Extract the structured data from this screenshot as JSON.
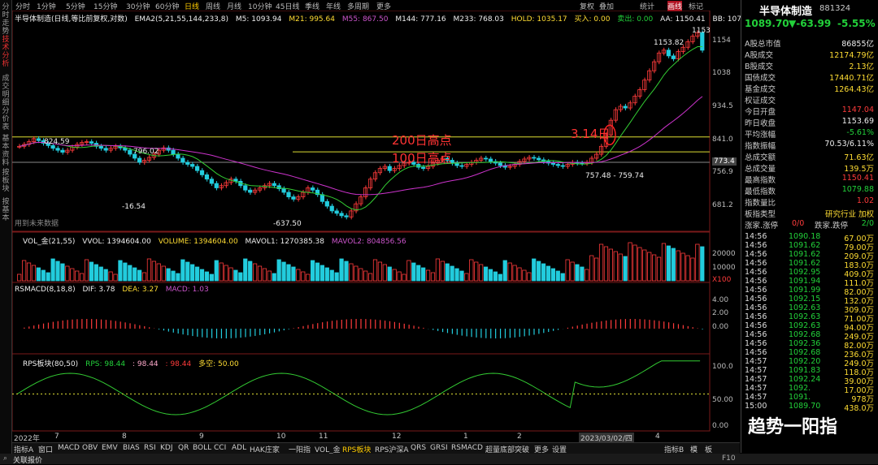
{
  "left_tabs": [
    "分时走势",
    "技术分析",
    "成交明细",
    "分价表",
    "基本资料",
    "按板块",
    "按基本"
  ],
  "toolbar": {
    "periods": [
      "分时",
      "1分钟",
      "5分钟",
      "15分钟",
      "30分钟",
      "60分钟",
      "日线",
      "周线",
      "月线",
      "10分钟",
      "45日线",
      "季线",
      "年线",
      "多周期",
      "更多"
    ],
    "selected_period": "日线",
    "right": [
      "复权",
      "叠加",
      "统计",
      "画线",
      "标记"
    ],
    "active_right": "画线"
  },
  "price_legend": {
    "title": "半导体制造(日线,等比前复权,对数)",
    "ema": "EMA2(5,21,55,144,233,8)",
    "m5": "M5: 1093.94",
    "m21": "M21: 995.64",
    "m55": "M55: 867.50",
    "m144": "M144: 777.16",
    "m233": "M233: 768.03",
    "hold": "HOLD: 1035.17",
    "buy": "买入: 0.00",
    "sell": "卖出: 0.00",
    "aa": "AA: 1150.41",
    "bb": "BB: 1079.88"
  },
  "annotations": {
    "high_label": "1153.82",
    "top_tick": "1153",
    "peak1": "824.59",
    "peak2": "796.02",
    "low1": "-16.54",
    "low2": "-637.50",
    "mid": "757.48 - 759.74",
    "line200": "200日高点",
    "line100": "100日高点",
    "circle": "3.14日",
    "future": "用到未来数据"
  },
  "price_ticks": [
    "1154",
    "1038",
    "934.5",
    "841.0",
    "773.4",
    "756.9",
    "681.2"
  ],
  "vol_legend": {
    "title": "VOL_金(21,55)",
    "vvol": "VVOL: 1394604.00",
    "volume": "VOLUME: 1394604.00",
    "mavol1": "MAVOL1: 1270385.38",
    "mavol2": "MAVOL2: 804856.56"
  },
  "vol_ticks": [
    "20000",
    "10000",
    "X100"
  ],
  "macd_legend": {
    "title": "RSMACD(8,18,8)",
    "dif": "DIF: 3.78",
    "dea": "DEA: 3.27",
    "macd": "MACD: 1.03"
  },
  "macd_ticks": [
    "4.00",
    "2.00",
    "0.00"
  ],
  "rps_legend": {
    "title": "RPS板块(80,50)",
    "rps": "RPS: 98.44",
    "v1": ": 98.44",
    "v2": ": 98.44",
    "duo": "多空: 50.00"
  },
  "rps_ticks": [
    "100.0",
    "50.00",
    "0.00"
  ],
  "x_axis": [
    "2022年",
    "7",
    "8",
    "9",
    "10",
    "11",
    "12",
    "1",
    "2",
    "2023/03/02/四",
    "4"
  ],
  "bottom_tabs": [
    "指标A",
    "窗口",
    "MACD",
    "OBV",
    "EMV",
    "BIAS",
    "RSI",
    "KDJ",
    "QR",
    "BOLL",
    "CCI",
    "ADL",
    "HAK庄家",
    "一阳指",
    "VOL_金",
    "RPS板块",
    "RPS沪深A",
    "QRS",
    "GRSI",
    "RSMACD",
    "超量底部突破",
    "更多",
    "设置"
  ],
  "bottom_right": [
    "指标B",
    "模",
    "板"
  ],
  "status_text": "关联报价",
  "status_right": "F10",
  "panel": {
    "title": "半导体制造",
    "code": "881324",
    "price": "1089.70",
    "change": "▼-63.99",
    "pct": "-5.55%",
    "rows": [
      {
        "k": "A股总市值",
        "v": "86855亿",
        "c": "white"
      },
      {
        "k": "A股成交",
        "v": "12174.79亿",
        "c": "yellow"
      },
      {
        "k": "B股成交",
        "v": "2.13亿",
        "c": "yellow"
      },
      {
        "k": "国债成交",
        "v": "17440.71亿",
        "c": "yellow"
      },
      {
        "k": "基金成交",
        "v": "1264.43亿",
        "c": "yellow"
      },
      {
        "k": "权证成交",
        "v": "",
        "c": "white"
      },
      {
        "k": "今日开盘",
        "v": "1147.04",
        "c": "red"
      },
      {
        "k": "昨日收盘",
        "v": "1153.69",
        "c": "white"
      },
      {
        "k": "平均涨幅",
        "v": "-5.61%",
        "c": "green"
      },
      {
        "k": "指数振幅",
        "v": "70.53/6.11%",
        "c": "white"
      },
      {
        "k": "总成交额",
        "v": "71.63亿",
        "c": "yellow"
      },
      {
        "k": "总成交量",
        "v": "139.5万",
        "c": "yellow"
      },
      {
        "k": "最高指数",
        "v": "1150.41",
        "c": "red"
      },
      {
        "k": "最低指数",
        "v": "1079.88",
        "c": "green"
      },
      {
        "k": "指数量比",
        "v": "1.02",
        "c": "red"
      }
    ],
    "sector_label": "板指类型",
    "sector_value": "研究行业 加权",
    "updown": {
      "k1": "涨家.涨停",
      "v1": "0/0",
      "k2": "跌家.跌停",
      "v2": "2/0"
    },
    "trades": [
      {
        "t": "14:56",
        "p": "1090.18",
        "v": "67.00万"
      },
      {
        "t": "14:56",
        "p": "1091.62",
        "v": "79.00万"
      },
      {
        "t": "14:56",
        "p": "1091.62",
        "v": "209.0万"
      },
      {
        "t": "14:56",
        "p": "1091.62",
        "v": "183.0万"
      },
      {
        "t": "14:56",
        "p": "1092.95",
        "v": "409.0万"
      },
      {
        "t": "14:56",
        "p": "1091.94",
        "v": "111.0万"
      },
      {
        "t": "14:56",
        "p": "1091.99",
        "v": "82.00万"
      },
      {
        "t": "14:56",
        "p": "1092.15",
        "v": "132.0万"
      },
      {
        "t": "14:56",
        "p": "1092.63",
        "v": "309.0万"
      },
      {
        "t": "14:56",
        "p": "1092.63",
        "v": "71.00万"
      },
      {
        "t": "14:56",
        "p": "1092.63",
        "v": "94.00万"
      },
      {
        "t": "14:56",
        "p": "1092.68",
        "v": "249.0万"
      },
      {
        "t": "14:56",
        "p": "1092.36",
        "v": "82.00万"
      },
      {
        "t": "14:56",
        "p": "1092.68",
        "v": "236.0万"
      },
      {
        "t": "14:57",
        "p": "1092.20",
        "v": "249.0万"
      },
      {
        "t": "14:57",
        "p": "1091.83",
        "v": "118.0万"
      },
      {
        "t": "14:57",
        "p": "1092.24",
        "v": "39.00万"
      },
      {
        "t": "14:57",
        "p": "1092.",
        "v": "17.00万"
      },
      {
        "t": "14:57",
        "p": "1091.",
        "v": "978万"
      },
      {
        "t": "15:00",
        "p": "1089.70",
        "v": "438.0万"
      }
    ]
  },
  "watermark": "趋势一阳指",
  "colors": {
    "up": "#ff3b3b",
    "down": "#22ccdd",
    "ma_yellow": "#ffee44",
    "ma_green": "#33cc33",
    "ma_purple": "#cc33cc",
    "hline": "#dddd33"
  },
  "chart_data": {
    "type": "candlestick",
    "series_note": "closing prices (approx, log scale)",
    "closes": [
      800,
      805,
      812,
      820,
      815,
      808,
      802,
      795,
      790,
      785,
      790,
      798,
      805,
      810,
      812,
      808,
      800,
      795,
      790,
      795,
      800,
      796,
      790,
      780,
      770,
      760,
      765,
      772,
      780,
      790,
      796,
      790,
      780,
      770,
      760,
      755,
      750,
      740,
      730,
      720,
      710,
      700,
      705,
      712,
      720,
      715,
      705,
      695,
      690,
      695,
      700,
      705,
      710,
      705,
      698,
      690,
      680,
      675,
      680,
      690,
      700,
      695,
      685,
      670,
      660,
      650,
      645,
      640,
      637.5,
      650,
      665,
      680,
      700,
      720,
      735,
      745,
      750,
      740,
      745,
      752,
      758,
      760,
      755,
      748,
      745,
      750,
      758,
      765,
      770,
      765,
      758,
      752,
      750,
      755,
      760,
      765,
      770,
      768,
      762,
      758,
      752,
      748,
      750,
      755,
      762,
      768,
      772,
      770,
      766,
      762,
      758,
      755,
      752,
      750,
      755,
      760,
      758,
      757.48,
      759.74,
      770,
      780,
      800,
      830,
      870,
      900,
      910,
      905,
      920,
      940,
      960,
      990,
      1020,
      1050,
      1080,
      1090,
      1070,
      1060,
      1085,
      1100,
      1120,
      1140,
      1153,
      1089.7
    ]
  }
}
